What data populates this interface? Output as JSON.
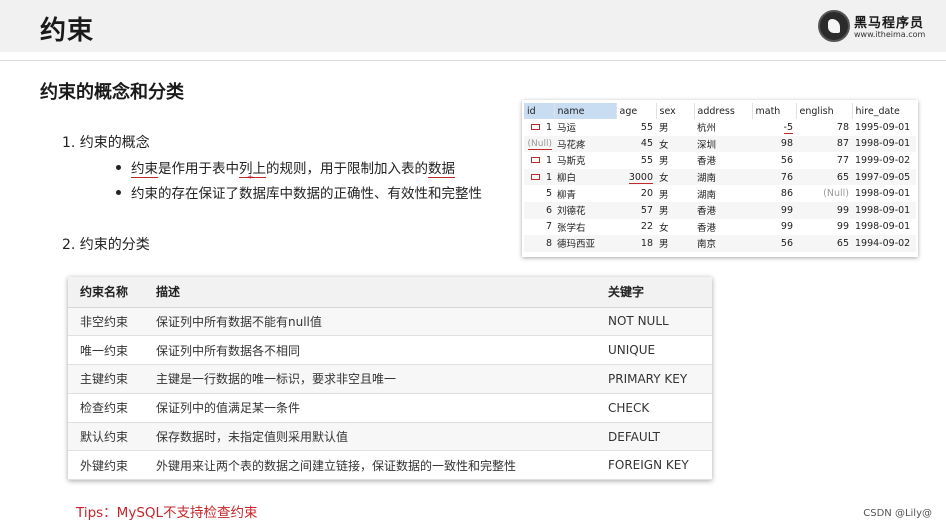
{
  "header": {
    "title": "约束"
  },
  "logo": {
    "name": "黑马程序员",
    "url": "www.itheima.com"
  },
  "section_title": "约束的概念和分类",
  "concept": {
    "title": "1. 约束的概念",
    "bullet1": {
      "text1": "约束",
      "text2": "是作用于表中",
      "text3": "列上",
      "text4": "的规则，用于限制加入表的",
      "text5": "数据"
    },
    "bullet2": "约束的存在保证了数据库中数据的正确性、有效性和完整性"
  },
  "classification_title": "2. 约束的分类",
  "sample": {
    "columns": [
      "id",
      "name",
      "age",
      "sex",
      "address",
      "math",
      "english",
      "hire_date"
    ],
    "rows": [
      {
        "id": "1",
        "name": "马运",
        "age": "55",
        "sex": "男",
        "address": "杭州",
        "math": "-5",
        "english": "78",
        "hire_date": "1995-09-01"
      },
      {
        "id": "(Null)",
        "name": "马花疼",
        "age": "45",
        "sex": "女",
        "address": "深圳",
        "math": "98",
        "english": "87",
        "hire_date": "1998-09-01"
      },
      {
        "id": "1",
        "name": "马斯克",
        "age": "55",
        "sex": "男",
        "address": "香港",
        "math": "56",
        "english": "77",
        "hire_date": "1999-09-02"
      },
      {
        "id": "1",
        "name": "柳白",
        "age": "3000",
        "sex": "女",
        "address": "湖南",
        "math": "76",
        "english": "65",
        "hire_date": "1997-09-05"
      },
      {
        "id": "5",
        "name": "柳青",
        "age": "20",
        "sex": "男",
        "address": "湖南",
        "math": "86",
        "english": "(Null)",
        "hire_date": "1998-09-01"
      },
      {
        "id": "6",
        "name": "刘德花",
        "age": "57",
        "sex": "男",
        "address": "香港",
        "math": "99",
        "english": "99",
        "hire_date": "1998-09-01"
      },
      {
        "id": "7",
        "name": "张学右",
        "age": "22",
        "sex": "女",
        "address": "香港",
        "math": "99",
        "english": "99",
        "hire_date": "1998-09-01"
      },
      {
        "id": "8",
        "name": "德玛西亚",
        "age": "18",
        "sex": "男",
        "address": "南京",
        "math": "56",
        "english": "65",
        "hire_date": "1994-09-02"
      }
    ]
  },
  "constraints": {
    "headers": [
      "约束名称",
      "描述",
      "关键字"
    ],
    "rows": [
      {
        "name": "非空约束",
        "desc": "保证列中所有数据不能有null值",
        "keyword": "NOT NULL"
      },
      {
        "name": "唯一约束",
        "desc": "保证列中所有数据各不相同",
        "keyword": "UNIQUE"
      },
      {
        "name": "主键约束",
        "desc": "主键是一行数据的唯一标识，要求非空且唯一",
        "keyword": "PRIMARY KEY"
      },
      {
        "name": "检查约束",
        "desc": "保证列中的值满足某一条件",
        "keyword": "CHECK"
      },
      {
        "name": "默认约束",
        "desc": "保存数据时，未指定值则采用默认值",
        "keyword": "DEFAULT"
      },
      {
        "name": "外键约束",
        "desc": "外键用来让两个表的数据之间建立链接，保证数据的一致性和完整性",
        "keyword": "FOREIGN KEY"
      }
    ]
  },
  "tips": "Tips：MySQL不支持检查约束",
  "watermark": "CSDN @Lily@",
  "colors": {
    "accent_red": "#c0282a",
    "header_bg": "#f1f1f1",
    "selected_column": "#c8dcf2"
  }
}
